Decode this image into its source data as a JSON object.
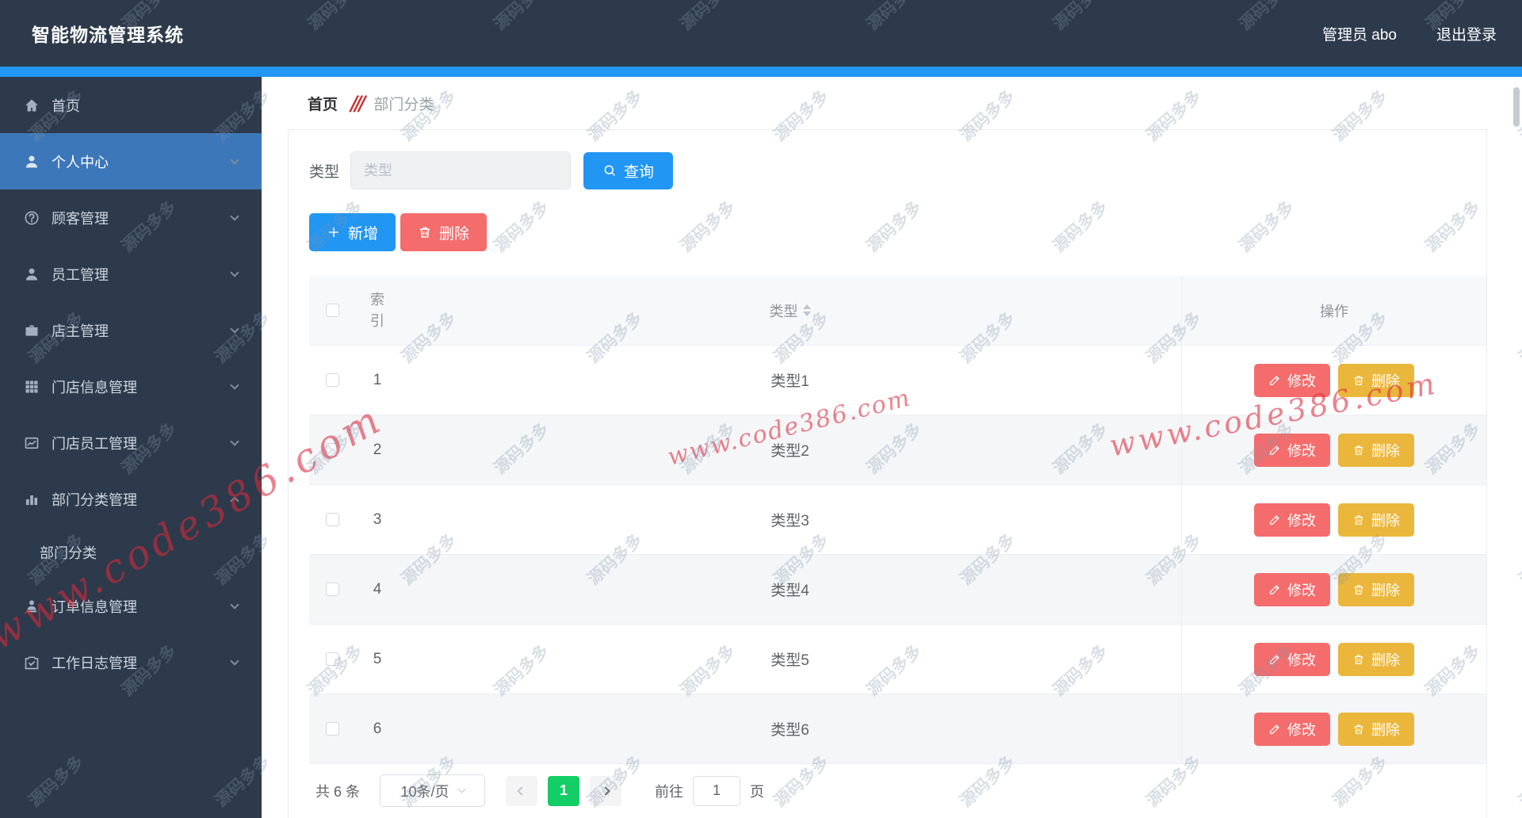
{
  "header": {
    "title": "智能物流管理系统",
    "admin_label": "管理员 abo",
    "logout_label": "退出登录"
  },
  "sidebar": {
    "items": [
      {
        "id": "home",
        "label": "首页",
        "icon": "home-icon",
        "active": false,
        "chevron": false,
        "sub": false
      },
      {
        "id": "profile-center",
        "label": "个人中心",
        "icon": "user-icon",
        "active": true,
        "chevron": true,
        "sub": false
      },
      {
        "id": "customer-mgmt",
        "label": "顾客管理",
        "icon": "question-icon",
        "active": false,
        "chevron": true,
        "sub": false
      },
      {
        "id": "employee-mgmt",
        "label": "员工管理",
        "icon": "user-icon",
        "active": false,
        "chevron": true,
        "sub": false
      },
      {
        "id": "shopowner-mgmt",
        "label": "店主管理",
        "icon": "briefcase-icon",
        "active": false,
        "chevron": true,
        "sub": false
      },
      {
        "id": "store-info-mgmt",
        "label": "门店信息管理",
        "icon": "grid-icon",
        "active": false,
        "chevron": true,
        "sub": false
      },
      {
        "id": "store-employee-mgmt",
        "label": "门店员工管理",
        "icon": "trend-icon",
        "active": false,
        "chevron": true,
        "sub": false
      },
      {
        "id": "dept-category-mgmt",
        "label": "部门分类管理",
        "icon": "barchart-icon",
        "active": false,
        "chevron": true,
        "expanded": true,
        "sub": false
      },
      {
        "id": "dept-category",
        "label": "部门分类",
        "icon": null,
        "active": false,
        "chevron": false,
        "sub": true
      },
      {
        "id": "order-info-mgmt",
        "label": "订单信息管理",
        "icon": "user-badge-icon",
        "active": false,
        "chevron": true,
        "sub": false
      },
      {
        "id": "worklog-mgmt",
        "label": "工作日志管理",
        "icon": "clipboard-icon",
        "active": false,
        "chevron": true,
        "sub": false
      }
    ]
  },
  "breadcrumb": {
    "home": "首页",
    "separator": "///",
    "current": "部门分类"
  },
  "search": {
    "label": "类型",
    "placeholder": "类型",
    "query_label": "查询"
  },
  "toolbar": {
    "add_label": "新增",
    "delete_label": "删除"
  },
  "table": {
    "columns": {
      "index": "索引",
      "type": "类型",
      "actions": "操作"
    },
    "rows": [
      {
        "index": "1",
        "type": "类型1"
      },
      {
        "index": "2",
        "type": "类型2"
      },
      {
        "index": "3",
        "type": "类型3"
      },
      {
        "index": "4",
        "type": "类型4"
      },
      {
        "index": "5",
        "type": "类型5"
      },
      {
        "index": "6",
        "type": "类型6"
      }
    ],
    "edit_label": "修改",
    "delete_label": "删除"
  },
  "pagination": {
    "total": "共 6 条",
    "page_size": "10条/页",
    "current_page": "1",
    "goto_label": "前往",
    "goto_value": "1",
    "page_suffix": "页"
  },
  "watermark": {
    "tile": "源码多多",
    "red": "www.code386.com"
  },
  "colors": {
    "accent_blue": "#2196f3",
    "danger_red": "#f56c6c",
    "warning_yellow": "#eab73c",
    "success_green": "#13ce66",
    "header_bg": "#2d3a4b",
    "sidebar_active_bg": "#3c78b9",
    "watermark_red": "#db2a3a"
  }
}
